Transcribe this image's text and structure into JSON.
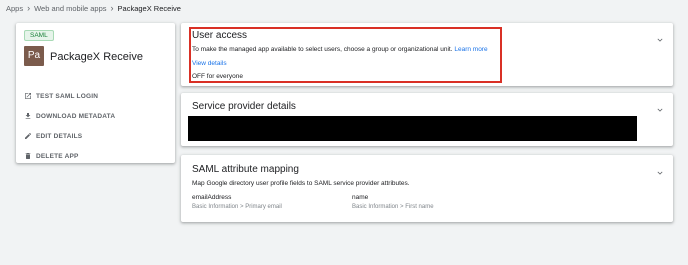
{
  "breadcrumb": {
    "items": [
      "Apps",
      "Web and mobile apps",
      "PackageX Receive"
    ]
  },
  "app": {
    "badge": "SAML",
    "logo_text": "Pa",
    "name": "PackageX Receive",
    "actions": [
      {
        "label": "TEST SAML LOGIN",
        "icon": "open-in-new-icon"
      },
      {
        "label": "DOWNLOAD METADATA",
        "icon": "download-icon"
      },
      {
        "label": "EDIT DETAILS",
        "icon": "pencil-icon"
      },
      {
        "label": "DELETE APP",
        "icon": "trash-icon"
      }
    ]
  },
  "user_access": {
    "title": "User access",
    "description": "To make the managed app available to select users, choose a group or organizational unit.",
    "learn_more": "Learn more",
    "view_details": "View details",
    "status": "OFF for everyone"
  },
  "service_provider": {
    "title": "Service provider details"
  },
  "saml_mapping": {
    "title": "SAML attribute mapping",
    "description": "Map Google directory user profile fields to SAML service provider attributes.",
    "mappings": [
      {
        "attribute": "emailAddress",
        "field": "Basic Information > Primary email"
      },
      {
        "attribute": "name",
        "field": "Basic Information > First name"
      }
    ]
  },
  "colors": {
    "accent": "#1a73e8",
    "highlight": "#d93025",
    "chip_green": "#188038",
    "logo_bg": "#7b5b4c"
  }
}
